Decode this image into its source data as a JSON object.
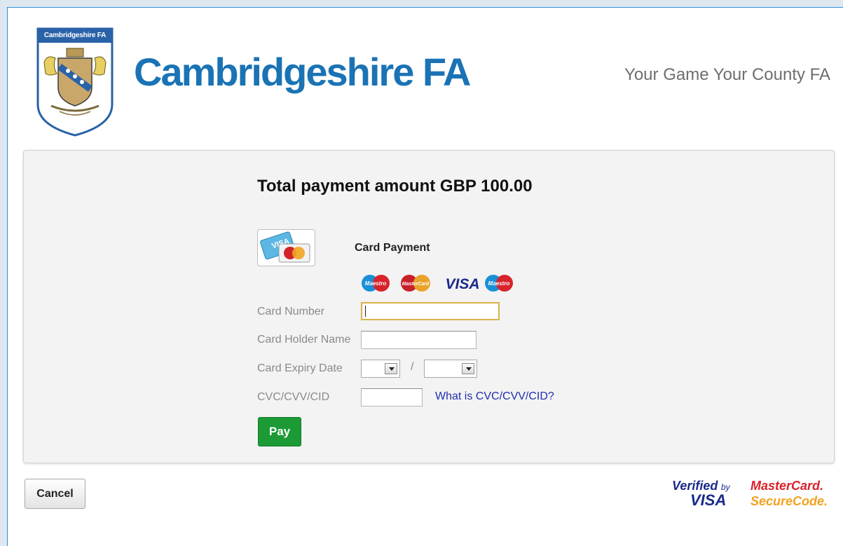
{
  "header": {
    "crest_label": "Cambridgeshire FA",
    "brand_name": "Cambridgeshire FA",
    "tagline": "Your Game Your County FA"
  },
  "payment": {
    "total_text": "Total payment amount GBP 100.00",
    "section_title": "Card Payment",
    "accepted_cards": [
      "Maestro",
      "MasterCard",
      "VISA",
      "Maestro"
    ],
    "fields": {
      "card_number_label": "Card Number",
      "card_number_value": "",
      "card_holder_label": "Card Holder Name",
      "card_holder_value": "",
      "expiry_label": "Card Expiry Date",
      "expiry_month_value": "",
      "expiry_year_value": "",
      "expiry_separator": "/",
      "cvc_label": "CVC/CVV/CID",
      "cvc_value": "",
      "cvc_help_link": "What is CVC/CVV/CID?"
    },
    "pay_label": "Pay"
  },
  "footer": {
    "cancel_label": "Cancel",
    "verified_by_visa": {
      "line1": "Verified",
      "by": "by",
      "line2": "VISA"
    },
    "mastercard_securecode": {
      "line1": "MasterCard.",
      "line2": "SecureCode."
    }
  },
  "colors": {
    "brand_blue": "#1a73b5",
    "pay_green": "#1c9a36",
    "link_blue": "#1f2fb0",
    "focus_border": "#d8b24a"
  }
}
